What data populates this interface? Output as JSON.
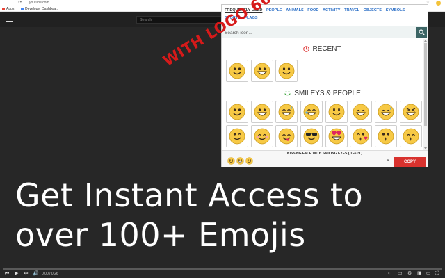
{
  "browser": {
    "url": "youtube.com",
    "bookmarks": [
      {
        "label": "Apps",
        "color": "#e94235"
      },
      {
        "label": "Developer Dashboa...",
        "color": "#4285f4"
      }
    ]
  },
  "yt": {
    "search_placeholder": "Search"
  },
  "headline": {
    "line1": "Get Instant Access to",
    "line2": "over 100+ Emojis"
  },
  "watermark": "WITH LOGO 66",
  "video": {
    "time": "0:00 / 0:26"
  },
  "popup": {
    "categories": [
      "FREQUENTLY USED",
      "PEOPLE",
      "ANIMALS",
      "FOOD",
      "ACTIVITY",
      "TRAVEL",
      "OBJECTS",
      "SYMBOLS",
      "SPORTS",
      "FLAGS"
    ],
    "search_placeholder": "Search icon...",
    "recent_title": "RECENT",
    "smileys_title": "SMILEYS & PEOPLE",
    "recent_emojis": [
      "slightly-smiling",
      "grinning-teeth",
      "smiling"
    ],
    "smileys_row1": [
      "slightly-smiling",
      "grinning-teeth",
      "grinning-sweat",
      "rolling-laughing",
      "neutral-smile",
      "grin-squint",
      "sweat-smile",
      "squinting-laugh"
    ],
    "smileys_row2": [
      "winking",
      "blushing",
      "yum",
      "sunglasses",
      "heart-eyes",
      "kissing-heart",
      "kissing",
      "kissing-smiling-eyes"
    ],
    "current_name": "KISSING FACE WITH SMILING EYES ( 1F619 )",
    "copy_label": "COPY",
    "clear_label": "×"
  },
  "colors": {
    "emoji_yellow": "#f7c945",
    "accent_blue": "#2a6ec6",
    "copy_red": "#d8322e",
    "watermark_red": "#d61a1a",
    "search_button": "#3c6565"
  }
}
